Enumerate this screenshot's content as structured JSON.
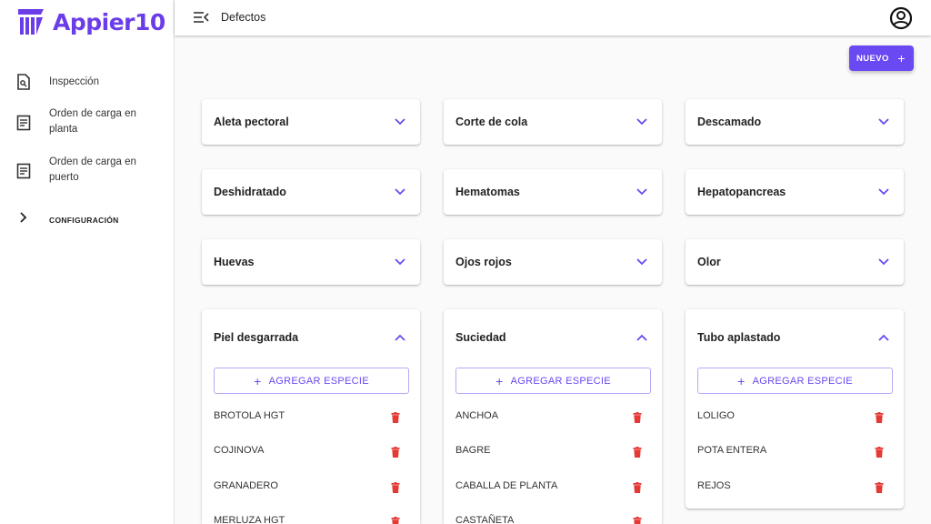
{
  "app": {
    "brand": "Appier10",
    "brand_color": "#6a3de8",
    "accent": "#6a48f2",
    "danger": "#e53935"
  },
  "sidebar": {
    "items": [
      {
        "label": "Inspección",
        "icon": "document-search-icon"
      },
      {
        "label": "Orden de carga en planta",
        "icon": "list-document-icon"
      },
      {
        "label": "Orden de carga en puerto",
        "icon": "list-document-icon"
      },
      {
        "label": "CONFIGURACIÓN",
        "icon": "chevron-right-icon"
      }
    ]
  },
  "header": {
    "title": "Defectos",
    "menu_icon": "menu-collapse-icon",
    "account_icon": "account-circle-icon"
  },
  "toolbar": {
    "new_label": "NUEVO",
    "new_icon": "plus-icon"
  },
  "defects": {
    "c0": {
      "title": "Aleta pectoral"
    },
    "c1": {
      "title": "Corte de cola"
    },
    "c2": {
      "title": "Descamado"
    },
    "c3": {
      "title": "Deshidratado"
    },
    "c4": {
      "title": "Hematomas"
    },
    "c5": {
      "title": "Hepatopancreas"
    },
    "c6": {
      "title": "Huevas"
    },
    "c7": {
      "title": "Ojos rojos"
    },
    "c8": {
      "title": "Olor"
    },
    "c9": {
      "title": "Piel desgarrada",
      "add_label": "AGREGAR ESPECIE",
      "species": [
        "BROTOLA HGT",
        "COJINOVA",
        "GRANADERO",
        "MERLUZA HGT"
      ]
    },
    "c10": {
      "title": "Suciedad",
      "add_label": "AGREGAR ESPECIE",
      "species": [
        "ANCHOA",
        "BAGRE",
        "CABALLA DE PLANTA",
        "CASTAÑETA"
      ]
    },
    "c11": {
      "title": "Tubo aplastado",
      "add_label": "AGREGAR ESPECIE",
      "species": [
        "LOLIGO",
        "POTA ENTERA",
        "REJOS"
      ]
    }
  }
}
